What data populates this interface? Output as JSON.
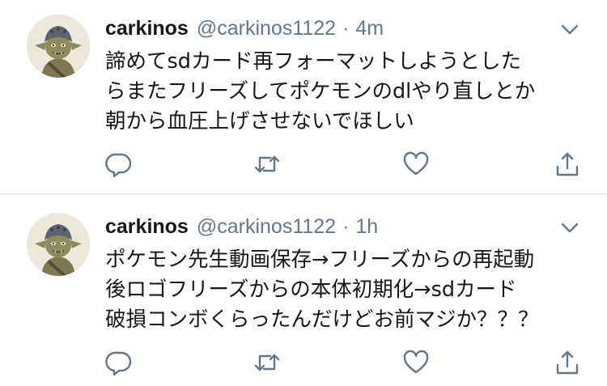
{
  "colors": {
    "name": "#14171a",
    "secondary": "#657786",
    "icon": "#657786",
    "divider": "#e6ecf0"
  },
  "tweets": [
    {
      "author_name": "carkinos",
      "handle": "@carkinos1122",
      "separator": "·",
      "time": "4m",
      "lines": [
        "諦めてsdカード再フォーマットしようとした",
        "らまたフリーズしてポケモンのdlやり直しとか",
        "朝から血圧上げさせないでほしい"
      ],
      "icons": [
        "reply-icon",
        "retweet-icon",
        "like-icon",
        "share-icon"
      ]
    },
    {
      "author_name": "carkinos",
      "handle": "@carkinos1122",
      "separator": "·",
      "time": "1h",
      "lines": [
        "ポケモン先生動画保存→フリーズからの再起動",
        "後ロゴフリーズからの本体初期化→sdカード",
        "破損コンボくらったんだけどお前マジか？？？"
      ],
      "icons": [
        "reply-icon",
        "retweet-icon",
        "like-icon",
        "share-icon"
      ]
    }
  ]
}
